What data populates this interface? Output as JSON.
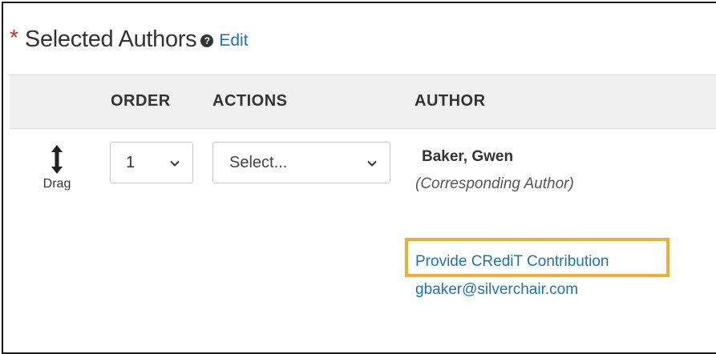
{
  "header": {
    "required_marker": "*",
    "title": "Selected Authors",
    "help_icon": "?",
    "edit_label": "Edit"
  },
  "table": {
    "columns": [
      "ORDER",
      "ACTIONS",
      "AUTHOR"
    ]
  },
  "row": {
    "drag_label": "Drag",
    "order_value": "1",
    "actions_placeholder": "Select...",
    "author_name": "Baker, Gwen",
    "author_role": "(Corresponding Author)",
    "credit_link": "Provide CRediT Contribution",
    "email": "gbaker@silverchair.com"
  },
  "colors": {
    "link": "#1a73b8",
    "required": "#d9261c",
    "highlight": "#f0ad2e",
    "header_bg": "#f0f0f0"
  }
}
